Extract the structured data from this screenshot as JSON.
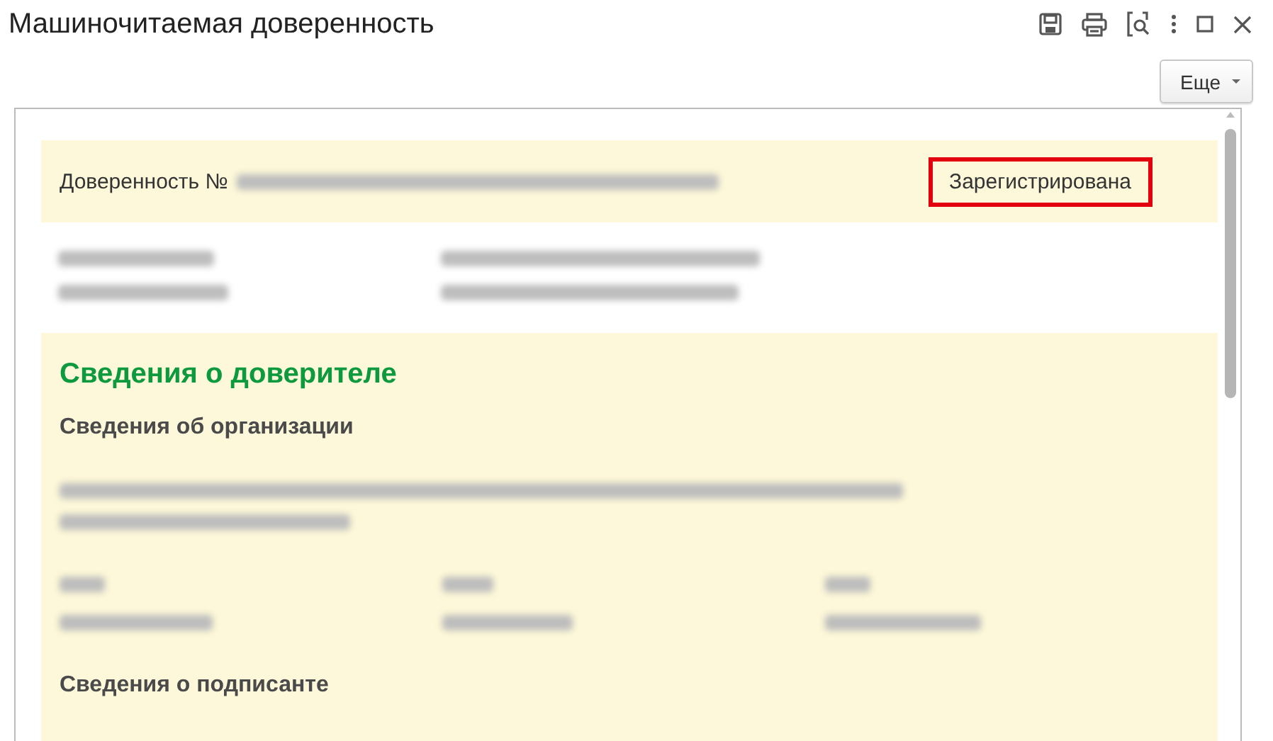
{
  "window": {
    "title": "Машиночитаемая доверенность"
  },
  "toolbar": {
    "more_button": "Еще"
  },
  "document": {
    "header": {
      "label": "Доверенность №",
      "status": "Зарегистрирована",
      "status_highlighted": true
    },
    "sections": [
      {
        "title": "Сведения о доверителе",
        "subsections": [
          {
            "title": "Сведения об организации"
          },
          {
            "title": "Сведения о подписанте"
          }
        ]
      }
    ]
  }
}
